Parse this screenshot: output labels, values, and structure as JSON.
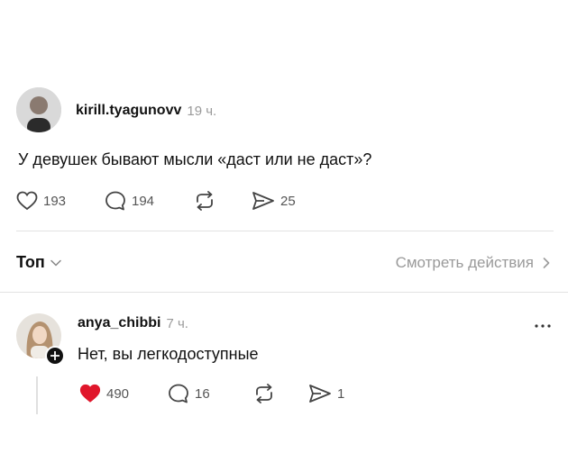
{
  "post": {
    "username": "kirill.tyagunovv",
    "time": "19 ч.",
    "text": "У девушек бывают мысли «даст или не даст»?",
    "likes": "193",
    "comments": "194",
    "shares": "25"
  },
  "filter": {
    "sort_label": "Топ",
    "view_activity": "Смотреть действия"
  },
  "reply": {
    "username": "anya_chibbi",
    "time": "7 ч.",
    "text": "Нет, вы легкодоступные",
    "likes": "490",
    "comments": "16",
    "shares": "1",
    "liked_color": "#e0162b"
  }
}
